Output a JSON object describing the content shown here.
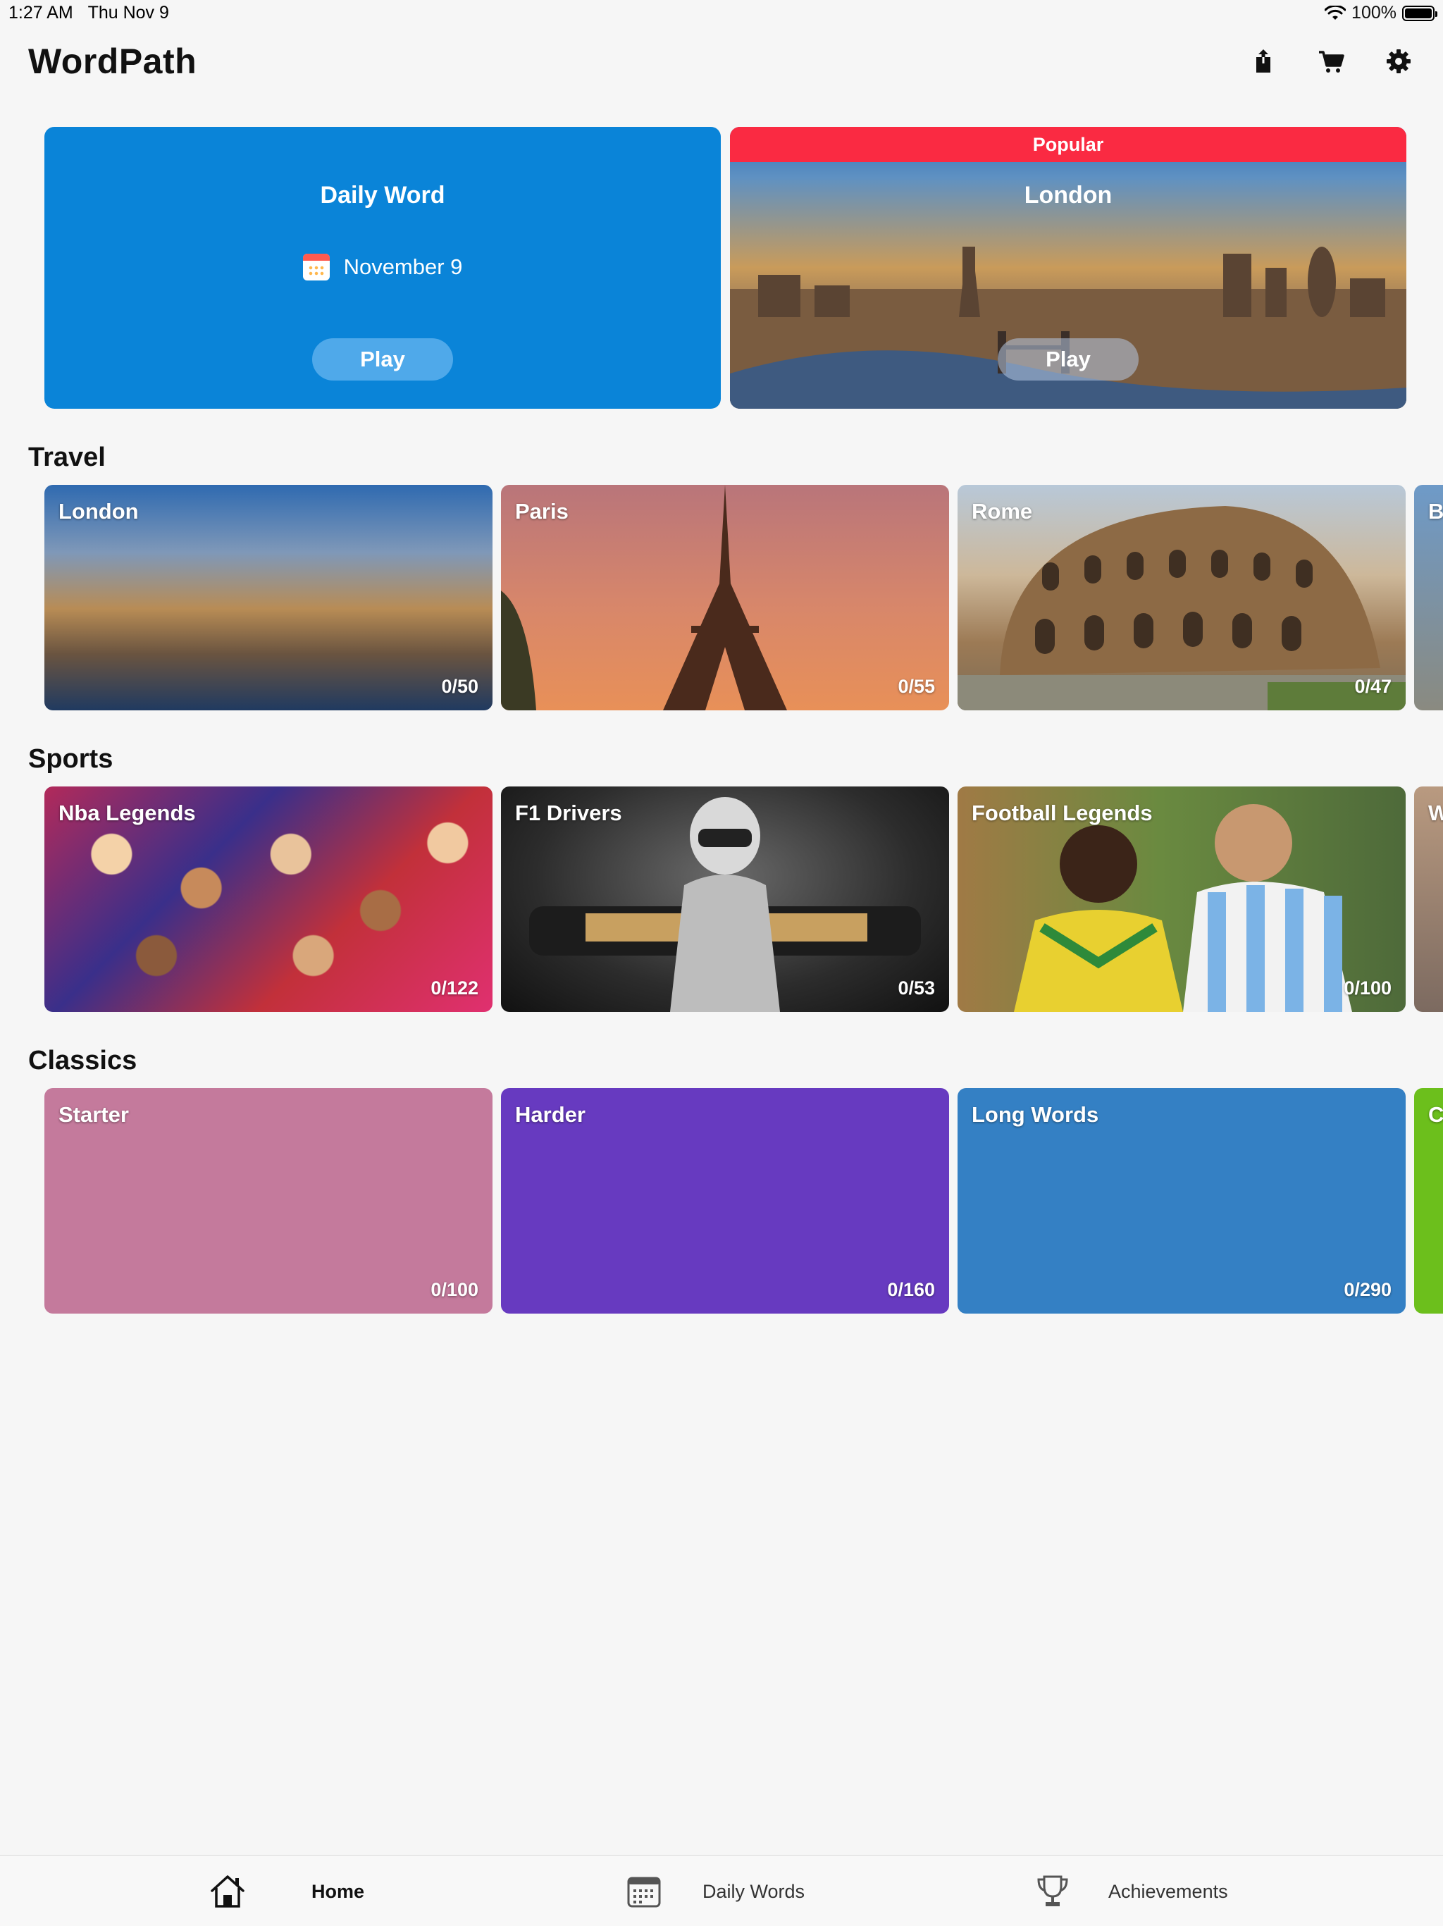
{
  "status_bar": {
    "time": "1:27 AM",
    "date": "Thu Nov 9",
    "battery": "100%"
  },
  "header": {
    "title": "WordPath",
    "actions": [
      {
        "name": "share",
        "icon": "share-icon"
      },
      {
        "name": "cart",
        "icon": "cart-icon"
      },
      {
        "name": "settings",
        "icon": "gear-icon"
      }
    ]
  },
  "hero": {
    "daily": {
      "title": "Daily Word",
      "date": "November 9",
      "play": "Play"
    },
    "popular": {
      "banner": "Popular",
      "title": "London",
      "play": "Play"
    }
  },
  "sections": {
    "travel": {
      "title": "Travel",
      "tiles": [
        {
          "label": "London",
          "count": "0/50"
        },
        {
          "label": "Paris",
          "count": "0/55"
        },
        {
          "label": "Rome",
          "count": "0/47"
        },
        {
          "label": "B",
          "count": ""
        }
      ]
    },
    "sports": {
      "title": "Sports",
      "tiles": [
        {
          "label": "Nba Legends",
          "count": "0/122"
        },
        {
          "label": "F1 Drivers",
          "count": "0/53"
        },
        {
          "label": "Football Legends",
          "count": "0/100"
        },
        {
          "label": "W",
          "count": ""
        }
      ]
    },
    "classics": {
      "title": "Classics",
      "tiles": [
        {
          "label": "Starter",
          "count": "0/100",
          "color": "#c47a9c"
        },
        {
          "label": "Harder",
          "count": "0/160",
          "color": "#673ac0"
        },
        {
          "label": "Long Words",
          "count": "0/290",
          "color": "#3480c4"
        },
        {
          "label": "C",
          "count": "",
          "color": "#6cbf1c"
        }
      ]
    }
  },
  "tab_bar": {
    "items": [
      {
        "label": "Home",
        "icon": "home-icon",
        "active": true
      },
      {
        "label": "Daily Words",
        "icon": "calendar-icon",
        "active": false
      },
      {
        "label": "Achievements",
        "icon": "trophy-icon",
        "active": false
      }
    ]
  }
}
